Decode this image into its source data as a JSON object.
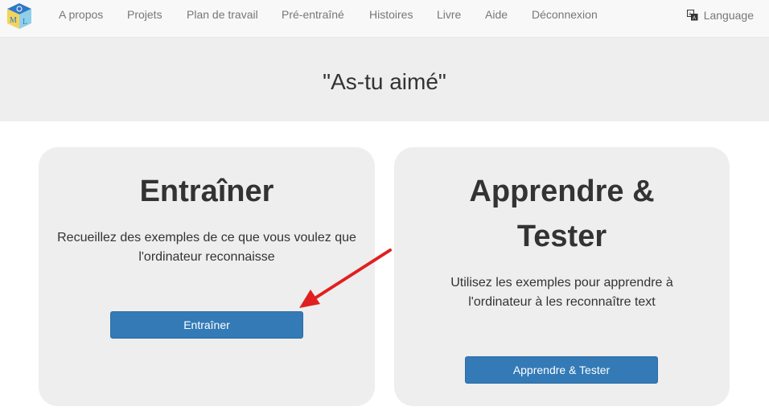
{
  "nav": {
    "items": [
      "A propos",
      "Projets",
      "Plan de travail",
      "Pré-entraîné",
      "Histoires",
      "Livre",
      "Aide",
      "Déconnexion"
    ],
    "language": "Language"
  },
  "page": {
    "title": "\"As-tu aimé\""
  },
  "cards": [
    {
      "title": "Entraîner",
      "description": "Recueillez des exemples de ce que vous voulez que l'ordinateur reconnaisse",
      "button": "Entraîner"
    },
    {
      "title": "Apprendre & Tester",
      "description": "Utilisez les exemples pour apprendre à l'ordinateur à les reconnaître text",
      "button": "Apprendre & Tester"
    }
  ],
  "colors": {
    "primary": "#337ab7",
    "annotation_arrow": "#e02020"
  }
}
